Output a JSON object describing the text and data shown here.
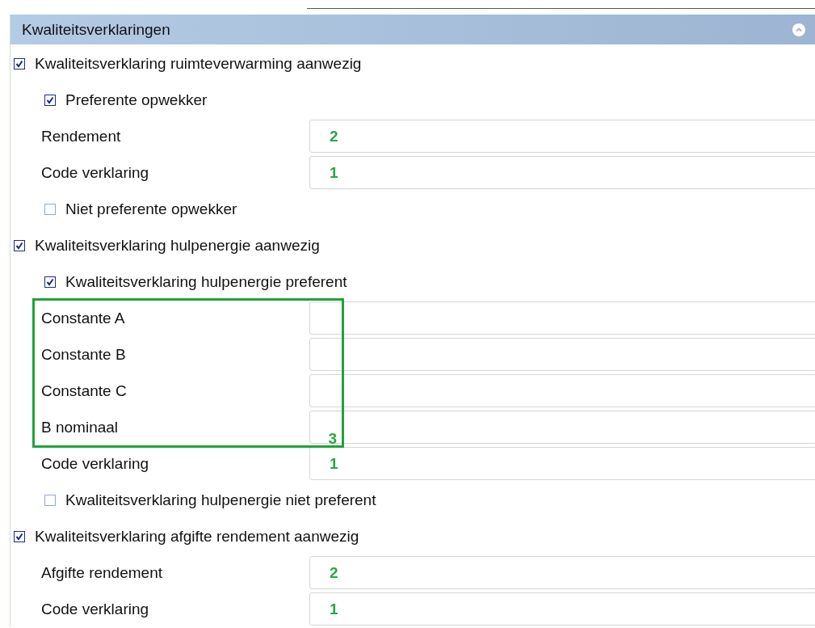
{
  "panel": {
    "title": "Kwaliteitsverklaringen",
    "expanded": true
  },
  "sections": [
    {
      "label": "Kwaliteitsverklaring ruimteverwarming aanwezig",
      "checked": true,
      "children": [
        {
          "kind": "checkbox",
          "label": "Preferente opwekker",
          "checked": true
        },
        {
          "kind": "field",
          "label": "Rendement",
          "annotation": "2"
        },
        {
          "kind": "field",
          "label": "Code verklaring",
          "annotation": "1"
        },
        {
          "kind": "checkbox",
          "label": "Niet preferente opwekker",
          "checked": false
        }
      ]
    },
    {
      "label": "Kwaliteitsverklaring hulpenergie aanwezig",
      "checked": true,
      "children": [
        {
          "kind": "checkbox",
          "label": "Kwaliteitsverklaring hulpenergie preferent",
          "checked": true
        },
        {
          "kind": "group",
          "annotation": "3",
          "children": [
            {
              "kind": "field",
              "label": "Constante A"
            },
            {
              "kind": "field",
              "label": "Constante B"
            },
            {
              "kind": "field",
              "label": "Constante C"
            },
            {
              "kind": "field",
              "label": "B nominaal"
            }
          ]
        },
        {
          "kind": "field",
          "label": "Code verklaring",
          "annotation": "1"
        },
        {
          "kind": "checkbox",
          "label": "Kwaliteitsverklaring hulpenergie niet preferent",
          "checked": false
        }
      ]
    },
    {
      "label": "Kwaliteitsverklaring afgifte rendement aanwezig",
      "checked": true,
      "children": [
        {
          "kind": "field",
          "label": "Afgifte rendement",
          "annotation": "2"
        },
        {
          "kind": "field",
          "label": "Code verklaring",
          "annotation": "1"
        }
      ]
    }
  ]
}
